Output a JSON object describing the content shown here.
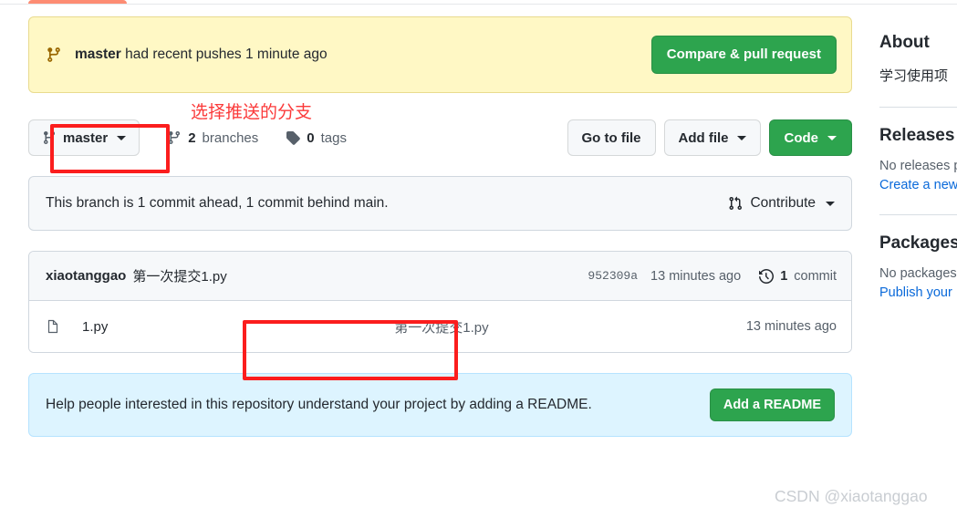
{
  "push_banner": {
    "branch": "master",
    "message": " had recent pushes 1 minute ago",
    "compare_button": "Compare & pull request"
  },
  "branch_row": {
    "current_branch": "master",
    "branches_count": "2",
    "branches_label": "branches",
    "tags_count": "0",
    "tags_label": "tags",
    "go_to_file": "Go to file",
    "add_file": "Add file",
    "code": "Code"
  },
  "status_box": {
    "text": "This branch is 1 commit ahead, 1 commit behind main.",
    "contribute": "Contribute"
  },
  "commit_header": {
    "author": "xiaotanggao",
    "message": "第一次提交1.py",
    "sha": "952309a",
    "when": "13 minutes ago",
    "commit_count": "1",
    "commit_count_label": "commit"
  },
  "files": [
    {
      "name": "1.py",
      "message": "第一次提交1.py",
      "when": "13 minutes ago"
    }
  ],
  "readme_prompt": {
    "text": "Help people interested in this repository understand your project by adding a README.",
    "button": "Add a README"
  },
  "sidebar": {
    "about": {
      "heading": "About",
      "description": "学习使用项"
    },
    "releases": {
      "heading": "Releases",
      "empty": "No releases p",
      "link": "Create a new"
    },
    "packages": {
      "heading": "Packages",
      "empty": "No packages",
      "link": "Publish your"
    }
  },
  "annotations": {
    "branch_note": "选择推送的分支"
  },
  "watermark": "CSDN @xiaotanggao",
  "colors": {
    "accent_green": "#2da44e",
    "banner_yellow": "#fff8c5",
    "readme_blue": "#ddf4ff",
    "annotation_red": "#fb1d1d",
    "tab_orange": "#fd8c73",
    "link_blue": "#0969da"
  }
}
